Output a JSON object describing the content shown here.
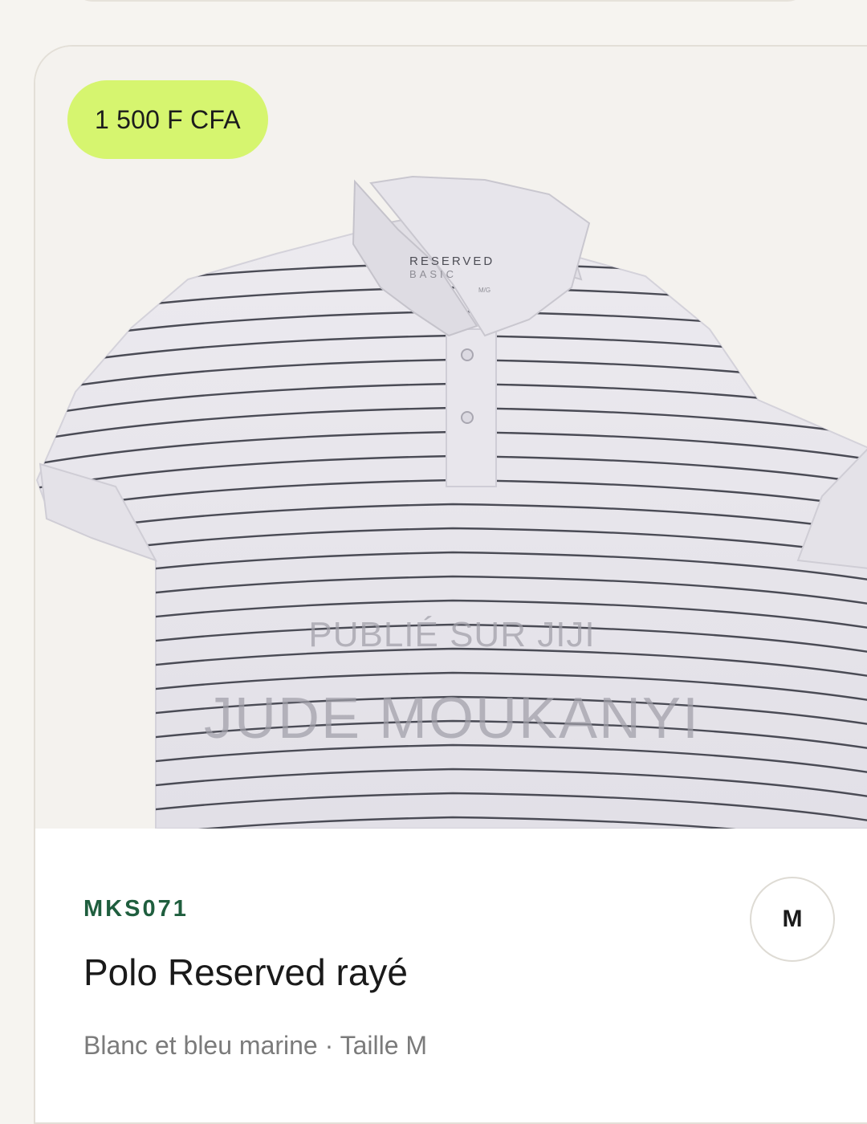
{
  "listing": {
    "price": "1 500 F CFA",
    "sku": "MKS071",
    "title": "Polo Reserved rayé",
    "subtitle": "Blanc et bleu marine · Taille M",
    "size_badge": "M"
  },
  "photo": {
    "watermark_line1": "PUBLIÉ SUR JIJI",
    "watermark_line2": "JUDE MOUKANYI",
    "label_brand": "RESERVED",
    "label_line2": "BASIC",
    "label_size": "M/G"
  },
  "colors": {
    "price_badge": "#d6f56f",
    "sku_text": "#1f5e3e",
    "shirt": "#e6e4ea",
    "stripe": "#4a4b55"
  }
}
